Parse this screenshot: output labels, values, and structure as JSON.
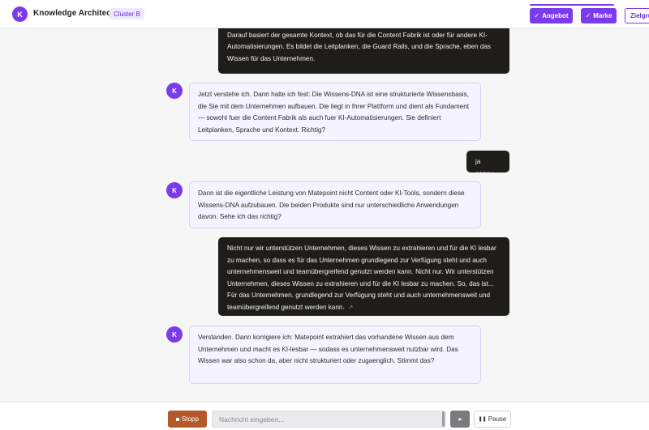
{
  "header": {
    "avatar_letter": "K",
    "title": "Knowledge Architect",
    "cluster_badge": "Cluster B",
    "progress_fraction": 0.4,
    "steps": [
      {
        "label": "Angebot",
        "check": "✓",
        "state": "done"
      },
      {
        "label": "Marke",
        "check": "✓",
        "state": "done"
      },
      {
        "label": "Zielgruppe",
        "state": "pending"
      }
    ]
  },
  "messages": [
    {
      "role": "user",
      "text": "Die DNA bzw. das Wissen liegt grundlegend in der Plattform und ist die Basis von allem. Darauf basiert der gesamte Kontext, ob das für die Content Fabrik ist oder für andere KI-Automatisierungen. Es bildet die Leitplanken, die Guard Rails, und die Sprache, eben das Wissen für das Unternehmen."
    },
    {
      "role": "assistant",
      "avatar": "K",
      "text": "Jetzt verstehe ich. Dann halte ich fest: Die Wissens-DNA ist eine strukturierte Wissensbasis, die Sie mit dem Unternehmen aufbauen. Die liegt in Ihrer Plattform und dient als Fundament — sowohl fuer die Content Fabrik als auch fuer KI-Automatisierungen. Sie definiert Leitplanken, Sprache und Kontext. Richtig?"
    },
    {
      "role": "user",
      "text": "ja genau"
    },
    {
      "role": "assistant",
      "avatar": "K",
      "text": "Dann ist die eigentliche Leistung von Matepoint nicht Content oder KI-Tools, sondern diese Wissens-DNA aufzubauen. Die beiden Produkte sind nur unterschiedliche Anwendungen davon. Sehe ich das richtig?"
    },
    {
      "role": "user",
      "text": "Nicht nur wir unterstützen Unternehmen, dieses Wissen zu extrahieren und für die KI lesbar zu machen, so dass es für das Unternehmen grundlegend zur Verfügung steht und auch unternehmensweit und teamübergreifend genutzt werden kann. Nicht nur. Wir unterstützen Unternehmen, dieses Wissen zu extrahieren und für die KI lesbar zu machen. So, das ist... Für das Unternehmen. grundlegend zur Verfügung steht und auch unternehmensweit und teamübergreifend genutzt werden kann.",
      "edit_icon": "↗"
    },
    {
      "role": "assistant",
      "avatar": "K",
      "text": "Verstanden. Dann korrigiere ich: Matepoint extrahiert das vorhandene Wissen aus dem Unternehmen und macht es KI-lesbar — sodass es unternehmensweit nutzbar wird. Das Wissen war also schon da, aber nicht strukturiert oder zugaenglich. Stimmt das?"
    }
  ],
  "footer": {
    "stop_label": "Stopp",
    "input_placeholder": "Nachricht eingeben...",
    "send_glyph": "➤",
    "pause_glyph": "❚❚",
    "pause_label": "Pause"
  },
  "colors": {
    "accent": "#7c3aed",
    "user_bubble": "#1f1d1a",
    "assistant_bubble": "#f5f3ff",
    "stop_button": "#b45a2a"
  }
}
